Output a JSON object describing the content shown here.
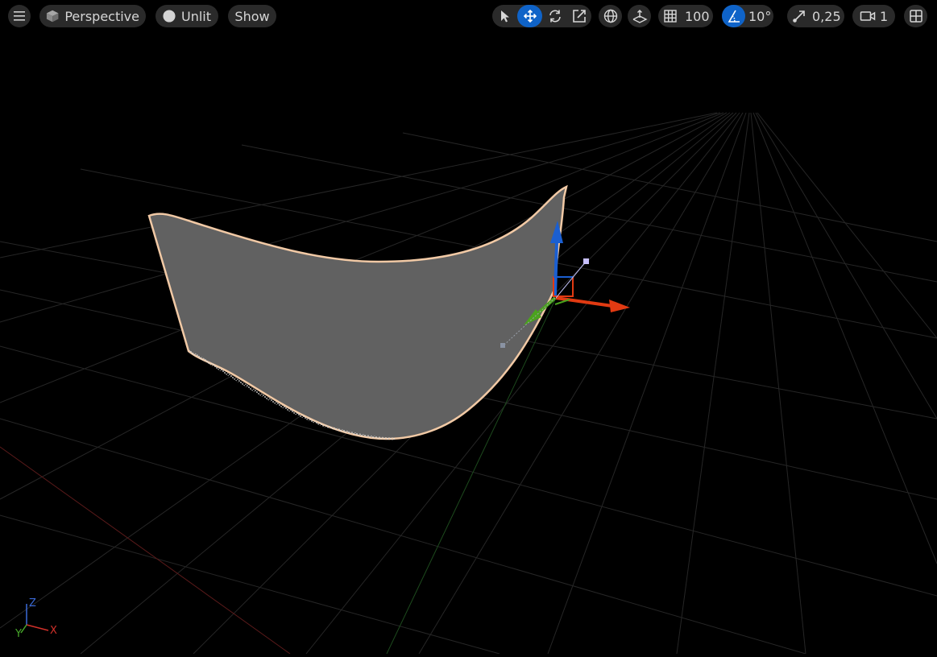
{
  "toolbar": {
    "menu_icon": "hamburger-icon",
    "view_mode_label": "Perspective",
    "view_mode_icon": "cube-icon",
    "lighting_label": "Unlit",
    "lighting_icon": "circle-icon",
    "show_label": "Show",
    "transform_tools": [
      {
        "name": "select",
        "icon": "cursor-arrow-icon",
        "active": false
      },
      {
        "name": "translate",
        "icon": "move-arrows-icon",
        "active": true
      },
      {
        "name": "rotate",
        "icon": "rotate-icon",
        "active": false
      },
      {
        "name": "scale",
        "icon": "scale-icon",
        "active": false
      }
    ],
    "coordinate_space_icon": "globe-icon",
    "surface_snap_icon": "surface-snap-icon",
    "grid_snap_value": "100",
    "grid_snap_icon": "grid-icon",
    "rotation_snap_value": "10°",
    "rotation_snap_icon": "angle-icon",
    "scale_snap_value": "0,25",
    "scale_snap_icon": "scale-arrow-icon",
    "camera_speed_value": "1",
    "camera_speed_icon": "camera-icon",
    "layout_icon": "viewport-layout-icon"
  },
  "axis_indicator": {
    "z": "Z",
    "y": "Y",
    "x": "X"
  },
  "colors": {
    "toolbar_bg": "#2a2a2a",
    "active_blue": "#0f63c8",
    "mesh_fill": "#616161",
    "mesh_outline": "#f1c9a5",
    "gizmo_x": "#e13a12",
    "gizmo_y": "#4aa31c",
    "gizmo_z": "#1b5fd1",
    "grid_line": "#2e2e2e"
  }
}
